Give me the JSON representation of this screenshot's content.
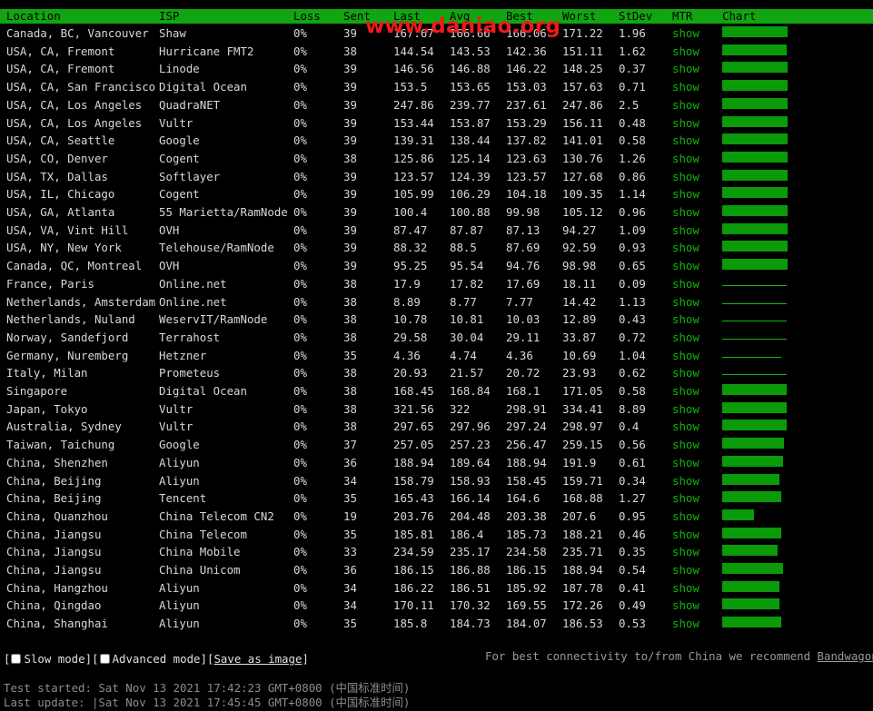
{
  "watermark": "www.daniao.org",
  "columns": [
    "Location",
    "ISP",
    "Loss",
    "Sent",
    "Last",
    "Avg",
    "Best",
    "Worst",
    "StDev",
    "MTR",
    "Chart"
  ],
  "rows": [
    {
      "location": "Canada, BC, Vancouver",
      "isp": "Shaw",
      "loss": "0%",
      "sent": "39",
      "last": "167.67",
      "avg": "166.66",
      "best": "166.06",
      "worst": "171.22",
      "stdev": "1.96",
      "mtr": "show",
      "bar": 0.59,
      "thin": false
    },
    {
      "location": "USA, CA, Fremont",
      "isp": "Hurricane FMT2",
      "loss": "0%",
      "sent": "38",
      "last": "144.54",
      "avg": "143.53",
      "best": "142.36",
      "worst": "151.11",
      "stdev": "1.62",
      "mtr": "show",
      "bar": 0.58,
      "thin": false
    },
    {
      "location": "USA, CA, Fremont",
      "isp": "Linode",
      "loss": "0%",
      "sent": "39",
      "last": "146.56",
      "avg": "146.88",
      "best": "146.22",
      "worst": "148.25",
      "stdev": "0.37",
      "mtr": "show",
      "bar": 0.59,
      "thin": false
    },
    {
      "location": "USA, CA, San Francisco",
      "isp": "Digital Ocean",
      "loss": "0%",
      "sent": "39",
      "last": "153.5",
      "avg": "153.65",
      "best": "153.03",
      "worst": "157.63",
      "stdev": "0.71",
      "mtr": "show",
      "bar": 0.59,
      "thin": false
    },
    {
      "location": "USA, CA, Los Angeles",
      "isp": "QuadraNET",
      "loss": "0%",
      "sent": "39",
      "last": "247.86",
      "avg": "239.77",
      "best": "237.61",
      "worst": "247.86",
      "stdev": "2.5",
      "mtr": "show",
      "bar": 0.59,
      "thin": false
    },
    {
      "location": "USA, CA, Los Angeles",
      "isp": "Vultr",
      "loss": "0%",
      "sent": "39",
      "last": "153.44",
      "avg": "153.87",
      "best": "153.29",
      "worst": "156.11",
      "stdev": "0.48",
      "mtr": "show",
      "bar": 0.59,
      "thin": false
    },
    {
      "location": "USA, CA, Seattle",
      "isp": "Google",
      "loss": "0%",
      "sent": "39",
      "last": "139.31",
      "avg": "138.44",
      "best": "137.82",
      "worst": "141.01",
      "stdev": "0.58",
      "mtr": "show",
      "bar": 0.59,
      "thin": false
    },
    {
      "location": "USA, CO, Denver",
      "isp": "Cogent",
      "loss": "0%",
      "sent": "38",
      "last": "125.86",
      "avg": "125.14",
      "best": "123.63",
      "worst": "130.76",
      "stdev": "1.26",
      "mtr": "show",
      "bar": 0.59,
      "thin": false
    },
    {
      "location": "USA, TX, Dallas",
      "isp": "Softlayer",
      "loss": "0%",
      "sent": "39",
      "last": "123.57",
      "avg": "124.39",
      "best": "123.57",
      "worst": "127.68",
      "stdev": "0.86",
      "mtr": "show",
      "bar": 0.59,
      "thin": false
    },
    {
      "location": "USA, IL, Chicago",
      "isp": "Cogent",
      "loss": "0%",
      "sent": "39",
      "last": "105.99",
      "avg": "106.29",
      "best": "104.18",
      "worst": "109.35",
      "stdev": "1.14",
      "mtr": "show",
      "bar": 0.59,
      "thin": false
    },
    {
      "location": "USA, GA, Atlanta",
      "isp": "55 Marietta/RamNode",
      "loss": "0%",
      "sent": "39",
      "last": "100.4",
      "avg": "100.88",
      "best": "99.98",
      "worst": "105.12",
      "stdev": "0.96",
      "mtr": "show",
      "bar": 0.59,
      "thin": false
    },
    {
      "location": "USA, VA, Vint Hill",
      "isp": "OVH",
      "loss": "0%",
      "sent": "39",
      "last": "87.47",
      "avg": "87.87",
      "best": "87.13",
      "worst": "94.27",
      "stdev": "1.09",
      "mtr": "show",
      "bar": 0.59,
      "thin": false
    },
    {
      "location": "USA, NY, New York",
      "isp": "Telehouse/RamNode",
      "loss": "0%",
      "sent": "39",
      "last": "88.32",
      "avg": "88.5",
      "best": "87.69",
      "worst": "92.59",
      "stdev": "0.93",
      "mtr": "show",
      "bar": 0.59,
      "thin": false
    },
    {
      "location": "Canada, QC, Montreal",
      "isp": "OVH",
      "loss": "0%",
      "sent": "39",
      "last": "95.25",
      "avg": "95.54",
      "best": "94.76",
      "worst": "98.98",
      "stdev": "0.65",
      "mtr": "show",
      "bar": 0.59,
      "thin": false
    },
    {
      "location": "France, Paris",
      "isp": "Online.net",
      "loss": "0%",
      "sent": "38",
      "last": "17.9",
      "avg": "17.82",
      "best": "17.69",
      "worst": "18.11",
      "stdev": "0.09",
      "mtr": "show",
      "bar": 0.58,
      "thin": true
    },
    {
      "location": "Netherlands, Amsterdam",
      "isp": "Online.net",
      "loss": "0%",
      "sent": "38",
      "last": "8.89",
      "avg": "8.77",
      "best": "7.77",
      "worst": "14.42",
      "stdev": "1.13",
      "mtr": "show",
      "bar": 0.58,
      "thin": true
    },
    {
      "location": "Netherlands, Nuland",
      "isp": "WeservIT/RamNode",
      "loss": "0%",
      "sent": "38",
      "last": "10.78",
      "avg": "10.81",
      "best": "10.03",
      "worst": "12.89",
      "stdev": "0.43",
      "mtr": "show",
      "bar": 0.58,
      "thin": true
    },
    {
      "location": "Norway, Sandefjord",
      "isp": "Terrahost",
      "loss": "0%",
      "sent": "38",
      "last": "29.58",
      "avg": "30.04",
      "best": "29.11",
      "worst": "33.87",
      "stdev": "0.72",
      "mtr": "show",
      "bar": 0.58,
      "thin": true
    },
    {
      "location": "Germany, Nuremberg",
      "isp": "Hetzner",
      "loss": "0%",
      "sent": "35",
      "last": "4.36",
      "avg": "4.74",
      "best": "4.36",
      "worst": "10.69",
      "stdev": "1.04",
      "mtr": "show",
      "bar": 0.53,
      "thin": true
    },
    {
      "location": "Italy, Milan",
      "isp": "Prometeus",
      "loss": "0%",
      "sent": "38",
      "last": "20.93",
      "avg": "21.57",
      "best": "20.72",
      "worst": "23.93",
      "stdev": "0.62",
      "mtr": "show",
      "bar": 0.58,
      "thin": true
    },
    {
      "location": "Singapore",
      "isp": "Digital Ocean",
      "loss": "0%",
      "sent": "38",
      "last": "168.45",
      "avg": "168.84",
      "best": "168.1",
      "worst": "171.05",
      "stdev": "0.58",
      "mtr": "show",
      "bar": 0.58,
      "thin": false
    },
    {
      "location": "Japan, Tokyo",
      "isp": "Vultr",
      "loss": "0%",
      "sent": "38",
      "last": "321.56",
      "avg": "322",
      "best": "298.91",
      "worst": "334.41",
      "stdev": "8.89",
      "mtr": "show",
      "bar": 0.58,
      "thin": false
    },
    {
      "location": "Australia, Sydney",
      "isp": "Vultr",
      "loss": "0%",
      "sent": "38",
      "last": "297.65",
      "avg": "297.96",
      "best": "297.24",
      "worst": "298.97",
      "stdev": "0.4",
      "mtr": "show",
      "bar": 0.58,
      "thin": false
    },
    {
      "location": "Taiwan, Taichung",
      "isp": "Google",
      "loss": "0%",
      "sent": "37",
      "last": "257.05",
      "avg": "257.23",
      "best": "256.47",
      "worst": "259.15",
      "stdev": "0.56",
      "mtr": "show",
      "bar": 0.56,
      "thin": false
    },
    {
      "location": "China, Shenzhen",
      "isp": "Aliyun",
      "loss": "0%",
      "sent": "36",
      "last": "188.94",
      "avg": "189.64",
      "best": "188.94",
      "worst": "191.9",
      "stdev": "0.61",
      "mtr": "show",
      "bar": 0.55,
      "thin": false
    },
    {
      "location": "China, Beijing",
      "isp": "Aliyun",
      "loss": "0%",
      "sent": "34",
      "last": "158.79",
      "avg": "158.93",
      "best": "158.45",
      "worst": "159.71",
      "stdev": "0.34",
      "mtr": "show",
      "bar": 0.52,
      "thin": false
    },
    {
      "location": "China, Beijing",
      "isp": "Tencent",
      "loss": "0%",
      "sent": "35",
      "last": "165.43",
      "avg": "166.14",
      "best": "164.6",
      "worst": "168.88",
      "stdev": "1.27",
      "mtr": "show",
      "bar": 0.53,
      "thin": false
    },
    {
      "location": "China, Quanzhou",
      "isp": "China Telecom CN2",
      "loss": "0%",
      "sent": "19",
      "last": "203.76",
      "avg": "204.48",
      "best": "203.38",
      "worst": "207.6",
      "stdev": "0.95",
      "mtr": "show",
      "bar": 0.29,
      "thin": false
    },
    {
      "location": "China, Jiangsu",
      "isp": "China Telecom",
      "loss": "0%",
      "sent": "35",
      "last": "185.81",
      "avg": "186.4",
      "best": "185.73",
      "worst": "188.21",
      "stdev": "0.46",
      "mtr": "show",
      "bar": 0.53,
      "thin": false
    },
    {
      "location": "China, Jiangsu",
      "isp": "China Mobile",
      "loss": "0%",
      "sent": "33",
      "last": "234.59",
      "avg": "235.17",
      "best": "234.58",
      "worst": "235.71",
      "stdev": "0.35",
      "mtr": "show",
      "bar": 0.5,
      "thin": false
    },
    {
      "location": "China, Jiangsu",
      "isp": "China Unicom",
      "loss": "0%",
      "sent": "36",
      "last": "186.15",
      "avg": "186.88",
      "best": "186.15",
      "worst": "188.94",
      "stdev": "0.54",
      "mtr": "show",
      "bar": 0.55,
      "thin": false
    },
    {
      "location": "China, Hangzhou",
      "isp": "Aliyun",
      "loss": "0%",
      "sent": "34",
      "last": "186.22",
      "avg": "186.51",
      "best": "185.92",
      "worst": "187.78",
      "stdev": "0.41",
      "mtr": "show",
      "bar": 0.52,
      "thin": false
    },
    {
      "location": "China, Qingdao",
      "isp": "Aliyun",
      "loss": "0%",
      "sent": "34",
      "last": "170.11",
      "avg": "170.32",
      "best": "169.55",
      "worst": "172.26",
      "stdev": "0.49",
      "mtr": "show",
      "bar": 0.52,
      "thin": false
    },
    {
      "location": "China, Shanghai",
      "isp": "Aliyun",
      "loss": "0%",
      "sent": "35",
      "last": "185.8",
      "avg": "184.73",
      "best": "184.07",
      "worst": "186.53",
      "stdev": "0.53",
      "mtr": "show",
      "bar": 0.53,
      "thin": false
    }
  ],
  "controls": {
    "open": "[",
    "slow_mode": "Slow mode",
    "mid": "][",
    "advanced_mode": "Advanced mode",
    "mid2": "][",
    "save_image": "Save as image",
    "close": "]"
  },
  "recommend": {
    "text": "For best connectivity to/from China we recommend ",
    "link": "BandwagonHo"
  },
  "test_started": "Test started: Sat Nov 13 2021 17:42:23 GMT+0800 (中国标准时间)",
  "last_update": "Last update: |Sat Nov 13 2021 17:45:45 GMT+0800 (中国标准时间)",
  "colors": {
    "header_bg": "#11a511",
    "bar": "#0a9a0a",
    "show_link": "#11b411",
    "watermark": "#ee1b1b"
  }
}
